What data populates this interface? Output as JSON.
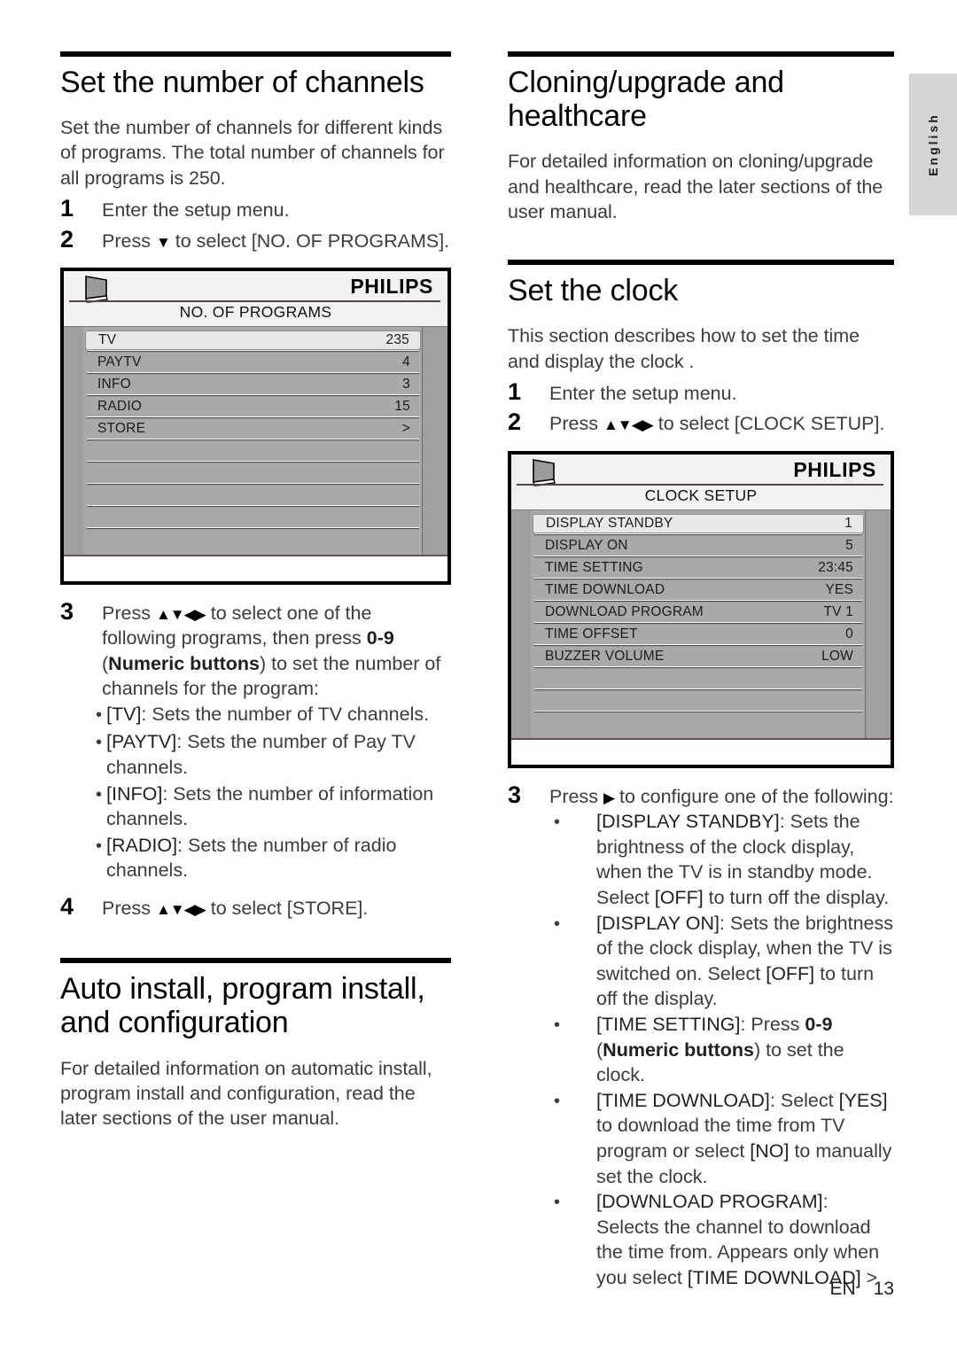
{
  "language_tab": {
    "label": "English"
  },
  "footer": {
    "locale": "EN",
    "page_number": "13"
  },
  "left_column": {
    "section1": {
      "heading": "Set the number of channels",
      "intro": "Set the number of channels for different kinds of programs. The total number of channels for all programs is 250.",
      "steps": [
        {
          "num": "1",
          "text": "Enter the setup menu."
        },
        {
          "num": "2",
          "text_before": "Press ",
          "arrows": "▼",
          "text_after": " to select [NO. OF PROGRAMS]."
        }
      ],
      "osd": {
        "brand": "PHILIPS",
        "tv_icon": "tv-icon",
        "title": "NO. OF PROGRAMS",
        "rows": [
          {
            "label": "TV",
            "value": "235",
            "selected": true
          },
          {
            "label": "PAYTV",
            "value": "4",
            "selected": false
          },
          {
            "label": "INFO",
            "value": "3",
            "selected": false
          },
          {
            "label": "RADIO",
            "value": "15",
            "selected": false
          },
          {
            "label": "STORE",
            "value": ">",
            "selected": false
          },
          {
            "label": "",
            "value": "",
            "selected": false
          },
          {
            "label": "",
            "value": "",
            "selected": false
          },
          {
            "label": "",
            "value": "",
            "selected": false
          },
          {
            "label": "",
            "value": "",
            "selected": false
          },
          {
            "label": "",
            "value": "",
            "selected": false
          }
        ]
      },
      "step3": {
        "num": "3",
        "line1_before": "Press ",
        "arrows": "▲▼◀▶",
        "line1_mid": " to select one of the following programs, then press ",
        "line1_bold1": "0-9",
        "line1_mid2": " (",
        "line1_bold2": "Numeric buttons",
        "line1_after": ") to set the number of channels for the program:"
      },
      "bullets": [
        {
          "key": "[TV]",
          "rest": ": Sets the number of TV channels."
        },
        {
          "key": "[PAYTV]",
          "rest": ": Sets the number of Pay TV channels."
        },
        {
          "key": "[INFO]",
          "rest": ": Sets the number of information channels."
        },
        {
          "key": "[RADIO]",
          "rest": ": Sets the number of radio channels."
        }
      ],
      "step4": {
        "num": "4",
        "before": "Press ",
        "arrows": "▲▼◀▶",
        "after": " to select [STORE]."
      }
    },
    "section2": {
      "heading": "Auto install, program install, and configuration",
      "body": "For detailed information on automatic install, program install and configuration, read the later sections of the user manual."
    }
  },
  "right_column": {
    "section1": {
      "heading": "Cloning/upgrade and healthcare",
      "body": "For detailed information on cloning/upgrade and healthcare, read the later sections of the user manual."
    },
    "section2": {
      "heading": "Set the clock",
      "intro": "This section describes how to set the time and display the clock .",
      "steps": [
        {
          "num": "1",
          "text": "Enter the setup menu."
        },
        {
          "num": "2",
          "text_before": "Press ",
          "arrows": "▲▼◀▶",
          "text_after": " to select [CLOCK SETUP]."
        }
      ],
      "osd": {
        "brand": "PHILIPS",
        "tv_icon": "tv-icon",
        "title": "CLOCK SETUP",
        "rows": [
          {
            "label": "DISPLAY STANDBY",
            "value": "1",
            "selected": true
          },
          {
            "label": "DISPLAY ON",
            "value": "5",
            "selected": false
          },
          {
            "label": "TIME SETTING",
            "value": "23:45",
            "selected": false
          },
          {
            "label": "TIME DOWNLOAD",
            "value": "YES",
            "selected": false
          },
          {
            "label": "DOWNLOAD PROGRAM",
            "value": "TV 1",
            "selected": false
          },
          {
            "label": "TIME OFFSET",
            "value": "0",
            "selected": false
          },
          {
            "label": "BUZZER VOLUME",
            "value": "LOW",
            "selected": false
          },
          {
            "label": "",
            "value": "",
            "selected": false
          },
          {
            "label": "",
            "value": "",
            "selected": false
          },
          {
            "label": "",
            "value": "",
            "selected": false
          }
        ]
      },
      "step3": {
        "num": "3",
        "before": "Press ",
        "arrows": "▶",
        "after": " to configure one of the following:"
      },
      "bullets": [
        {
          "key": "[DISPLAY STANDBY]",
          "rest": ": Sets the brightness of the clock display, when the TV is in standby mode. Select ",
          "key2": "[OFF]",
          "rest2": " to turn off the display."
        },
        {
          "key": "[DISPLAY ON]",
          "rest": ": Sets the brightness of the clock display, when the TV is switched on. Select ",
          "key2": "[OFF]",
          "rest2": " to turn off the display."
        },
        {
          "key": "[TIME SETTING]",
          "rest": ": Press ",
          "bold1": "0-9",
          "rest2": " (",
          "bold2": "Numeric buttons",
          "rest3": ") to set the clock."
        },
        {
          "key": "[TIME DOWNLOAD]",
          "rest": ": Select ",
          "key2": "[YES]",
          "rest2": " to download the time from TV program or select ",
          "key3": "[NO]",
          "rest3": " to manually set the clock."
        },
        {
          "key": "[DOWNLOAD PROGRAM]",
          "rest": ": Selects the channel to download the time from. Appears only when you select ",
          "key2": "[TIME DOWNLOAD]",
          "rest2": " >"
        }
      ]
    }
  }
}
